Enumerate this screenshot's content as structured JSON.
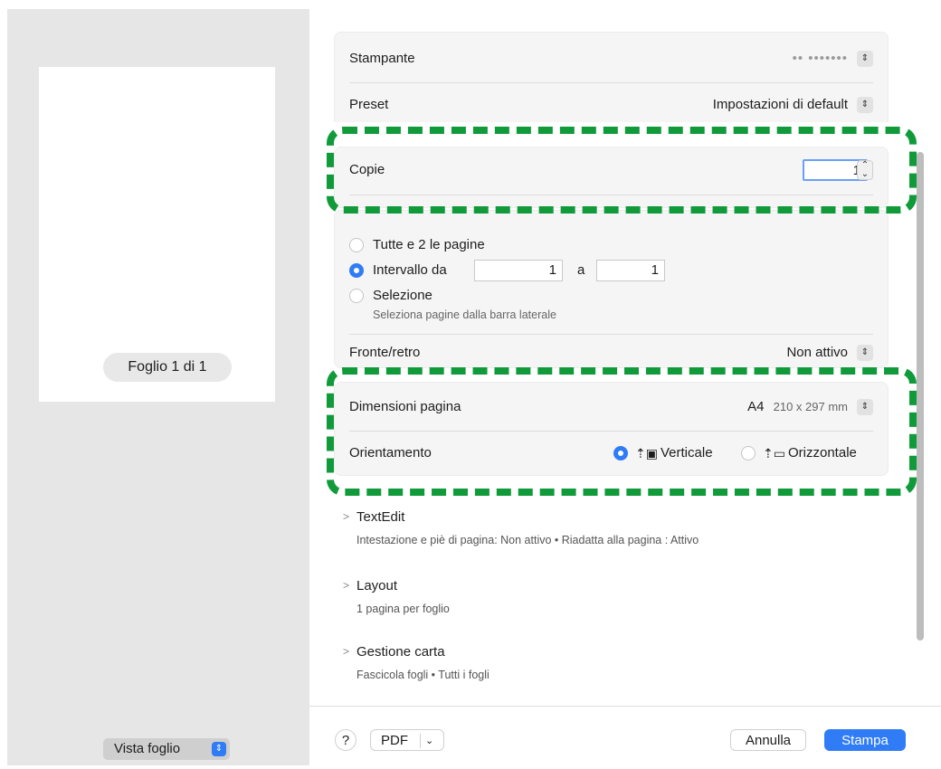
{
  "preview": {
    "sheet_label": "Foglio 1 di 1",
    "view_select": "Vista foglio"
  },
  "printer": {
    "label": "Stampante",
    "value": "•• ••••••• "
  },
  "preset": {
    "label": "Preset",
    "value": "Impostazioni di default"
  },
  "copies": {
    "label": "Copie",
    "value": "1"
  },
  "pages": {
    "all_label": "Tutte e 2 le pagine",
    "range_label": "Intervallo da",
    "range_from": "1",
    "range_to_label": "a",
    "range_to": "1",
    "selection_label": "Selezione",
    "selection_hint": "Seleziona pagine dalla barra laterale",
    "selected_option": "range"
  },
  "duplex": {
    "label": "Fronte/retro",
    "value": "Non attivo"
  },
  "paper_size": {
    "label": "Dimensioni pagina",
    "value": "A4",
    "detail": "210 x 297 mm"
  },
  "orientation": {
    "label": "Orientamento",
    "portrait_label": "Verticale",
    "landscape_label": "Orizzontale",
    "selected": "portrait"
  },
  "sections": [
    {
      "title": "TextEdit",
      "summary": "Intestazione e piè di pagina: Non attivo • Riadatta alla pagina : Attivo"
    },
    {
      "title": "Layout",
      "summary": "1 pagina per foglio"
    },
    {
      "title": "Gestione carta",
      "summary": "Fascicola fogli • Tutti i fogli"
    }
  ],
  "footer": {
    "help_label": "?",
    "pdf_label": "PDF",
    "cancel_label": "Annulla",
    "print_label": "Stampa"
  },
  "colors": {
    "accent": "#2f7cf6",
    "highlight": "#109a3a"
  }
}
